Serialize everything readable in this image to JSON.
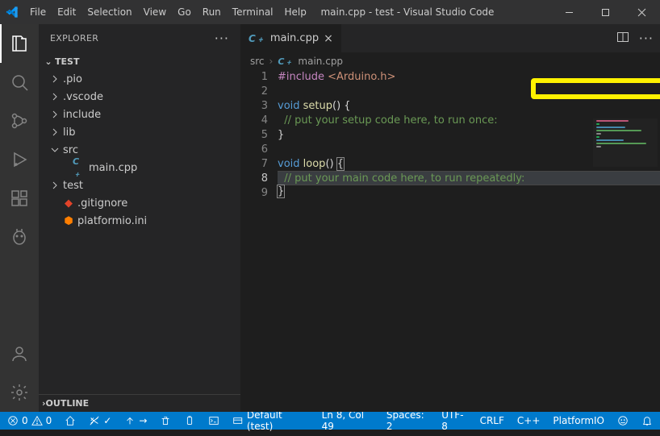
{
  "title": "main.cpp - test - Visual Studio Code",
  "menu": [
    "File",
    "Edit",
    "Selection",
    "View",
    "Go",
    "Run",
    "Terminal",
    "Help"
  ],
  "explorer": {
    "header": "EXPLORER",
    "root": "TEST",
    "items": [
      {
        "type": "folder",
        "label": ".pio",
        "open": false,
        "depth": 0
      },
      {
        "type": "folder",
        "label": ".vscode",
        "open": false,
        "depth": 0
      },
      {
        "type": "folder",
        "label": "include",
        "open": false,
        "depth": 0
      },
      {
        "type": "folder",
        "label": "lib",
        "open": false,
        "depth": 0
      },
      {
        "type": "folder",
        "label": "src",
        "open": true,
        "depth": 0
      },
      {
        "type": "file",
        "label": "main.cpp",
        "icon": "cpp",
        "depth": 1
      },
      {
        "type": "folder",
        "label": "test",
        "open": false,
        "depth": 0
      },
      {
        "type": "file",
        "label": ".gitignore",
        "icon": "git",
        "depth": 0
      },
      {
        "type": "file",
        "label": "platformio.ini",
        "icon": "pio",
        "depth": 0
      }
    ],
    "outline": "OUTLINE"
  },
  "tab": {
    "label": "main.cpp",
    "icon": "C﹢"
  },
  "crumbs": {
    "folder": "src",
    "file": "main.cpp"
  },
  "code": {
    "lines": [
      {
        "n": 1,
        "seg": [
          {
            "c": "k-inc",
            "t": "#include"
          },
          {
            "c": "",
            "t": " "
          },
          {
            "c": "k-lib",
            "t": "<Arduino.h>"
          }
        ]
      },
      {
        "n": 2,
        "seg": []
      },
      {
        "n": 3,
        "seg": [
          {
            "c": "k-void",
            "t": "void"
          },
          {
            "c": "",
            "t": " "
          },
          {
            "c": "k-fn",
            "t": "setup"
          },
          {
            "c": "k-br",
            "t": "() {"
          }
        ]
      },
      {
        "n": 4,
        "seg": [
          {
            "c": "",
            "t": "  "
          },
          {
            "c": "k-cm",
            "t": "// put your setup code here, to run once:"
          }
        ]
      },
      {
        "n": 5,
        "seg": [
          {
            "c": "k-br",
            "t": "}"
          }
        ]
      },
      {
        "n": 6,
        "seg": []
      },
      {
        "n": 7,
        "seg": [
          {
            "c": "k-void",
            "t": "void"
          },
          {
            "c": "",
            "t": " "
          },
          {
            "c": "k-fn",
            "t": "loop"
          },
          {
            "c": "k-br",
            "t": "() "
          },
          {
            "c": "k-br box",
            "t": "{"
          }
        ]
      },
      {
        "n": 8,
        "seg": [
          {
            "c": "",
            "t": "  "
          },
          {
            "c": "k-cm",
            "t": "// put your main code here, to run repeatedly:"
          }
        ],
        "current": true
      },
      {
        "n": 9,
        "seg": [
          {
            "c": "k-br box",
            "t": "}"
          }
        ]
      }
    ]
  },
  "annotation": {
    "bangs": "!!"
  },
  "status": {
    "errors": "0",
    "warnings": "0",
    "env": "Default (test)",
    "pos": "Ln 8, Col 49",
    "spaces": "Spaces: 2",
    "enc": "UTF-8",
    "eol": "CRLF",
    "lang": "C++",
    "platform": "PlatformIO"
  }
}
